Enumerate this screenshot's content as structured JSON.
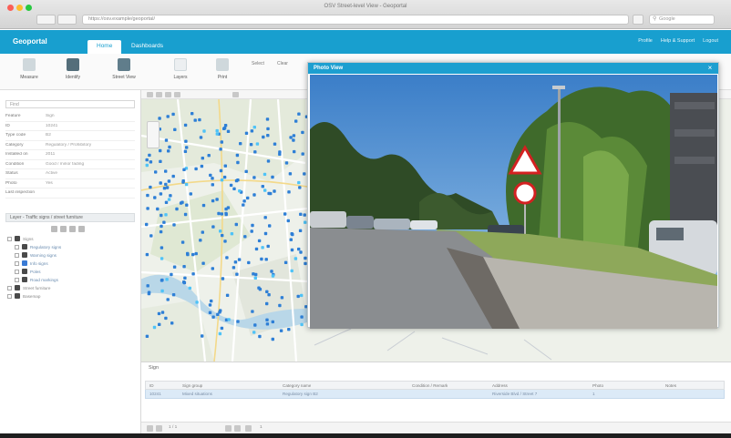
{
  "browser": {
    "window_title": "OSV Street-level View - Geoportal",
    "address": "https://osv.example/geoportal/",
    "search_placeholder": "Google"
  },
  "app": {
    "logo": "Geoportal",
    "tabs": [
      {
        "label": "Home",
        "active": true
      },
      {
        "label": "Dashboards",
        "active": false
      }
    ],
    "header_links": [
      "Profile",
      "Help & Support",
      "Logout"
    ]
  },
  "ribbon": {
    "buttons": [
      "Measure",
      "Identify",
      "Street View",
      "Layers",
      "Print"
    ],
    "small_labels": [
      "Select",
      "Clear"
    ]
  },
  "left_panel": {
    "search_placeholder": "Find",
    "properties": [
      {
        "key": "Feature",
        "value": "Sign"
      },
      {
        "key": "ID",
        "value": "10241"
      },
      {
        "key": "Type code",
        "value": "B2"
      },
      {
        "key": "Category",
        "value": "Regulatory / Prohibitory"
      },
      {
        "key": "Installed on",
        "value": "2011"
      },
      {
        "key": "Condition",
        "value": "Good / minor fading"
      },
      {
        "key": "Status",
        "value": "Active"
      },
      {
        "key": "Photo",
        "value": "Yes"
      },
      {
        "key": "Last inspection",
        "value": ""
      }
    ],
    "layers_header": "Layer - Traffic signs / street furniture",
    "layers": [
      {
        "label": "Signs",
        "color": "dark",
        "grey": true
      },
      {
        "label": "Regulatory signs",
        "color": "dark",
        "grey": false
      },
      {
        "label": "Warning signs",
        "color": "dark",
        "grey": false
      },
      {
        "label": "Info signs",
        "color": "blue",
        "grey": false
      },
      {
        "label": "Poles",
        "color": "dark",
        "grey": false
      },
      {
        "label": "Road markings",
        "color": "dark",
        "grey": false
      },
      {
        "label": "Street furniture",
        "color": "dark",
        "grey": true
      },
      {
        "label": "Basemap",
        "color": "dark",
        "grey": true
      }
    ]
  },
  "popup": {
    "title": "Photo View",
    "close_glyph": "×"
  },
  "table": {
    "tab_label": "Sign",
    "columns": [
      "ID",
      "Sign group",
      "Category name",
      "",
      "",
      "Condition / Remark",
      "Address",
      "Photo",
      "Notes"
    ],
    "row": [
      "10241",
      "Mixed situations",
      "Regulatory sign B2",
      "",
      "",
      "",
      "Riverside Blvd / Street 7",
      "1",
      ""
    ]
  },
  "status": {
    "page_info": "1 / 1",
    "count": "1"
  },
  "colors": {
    "brand": "#189fcf",
    "point": "#2e7fd6"
  }
}
